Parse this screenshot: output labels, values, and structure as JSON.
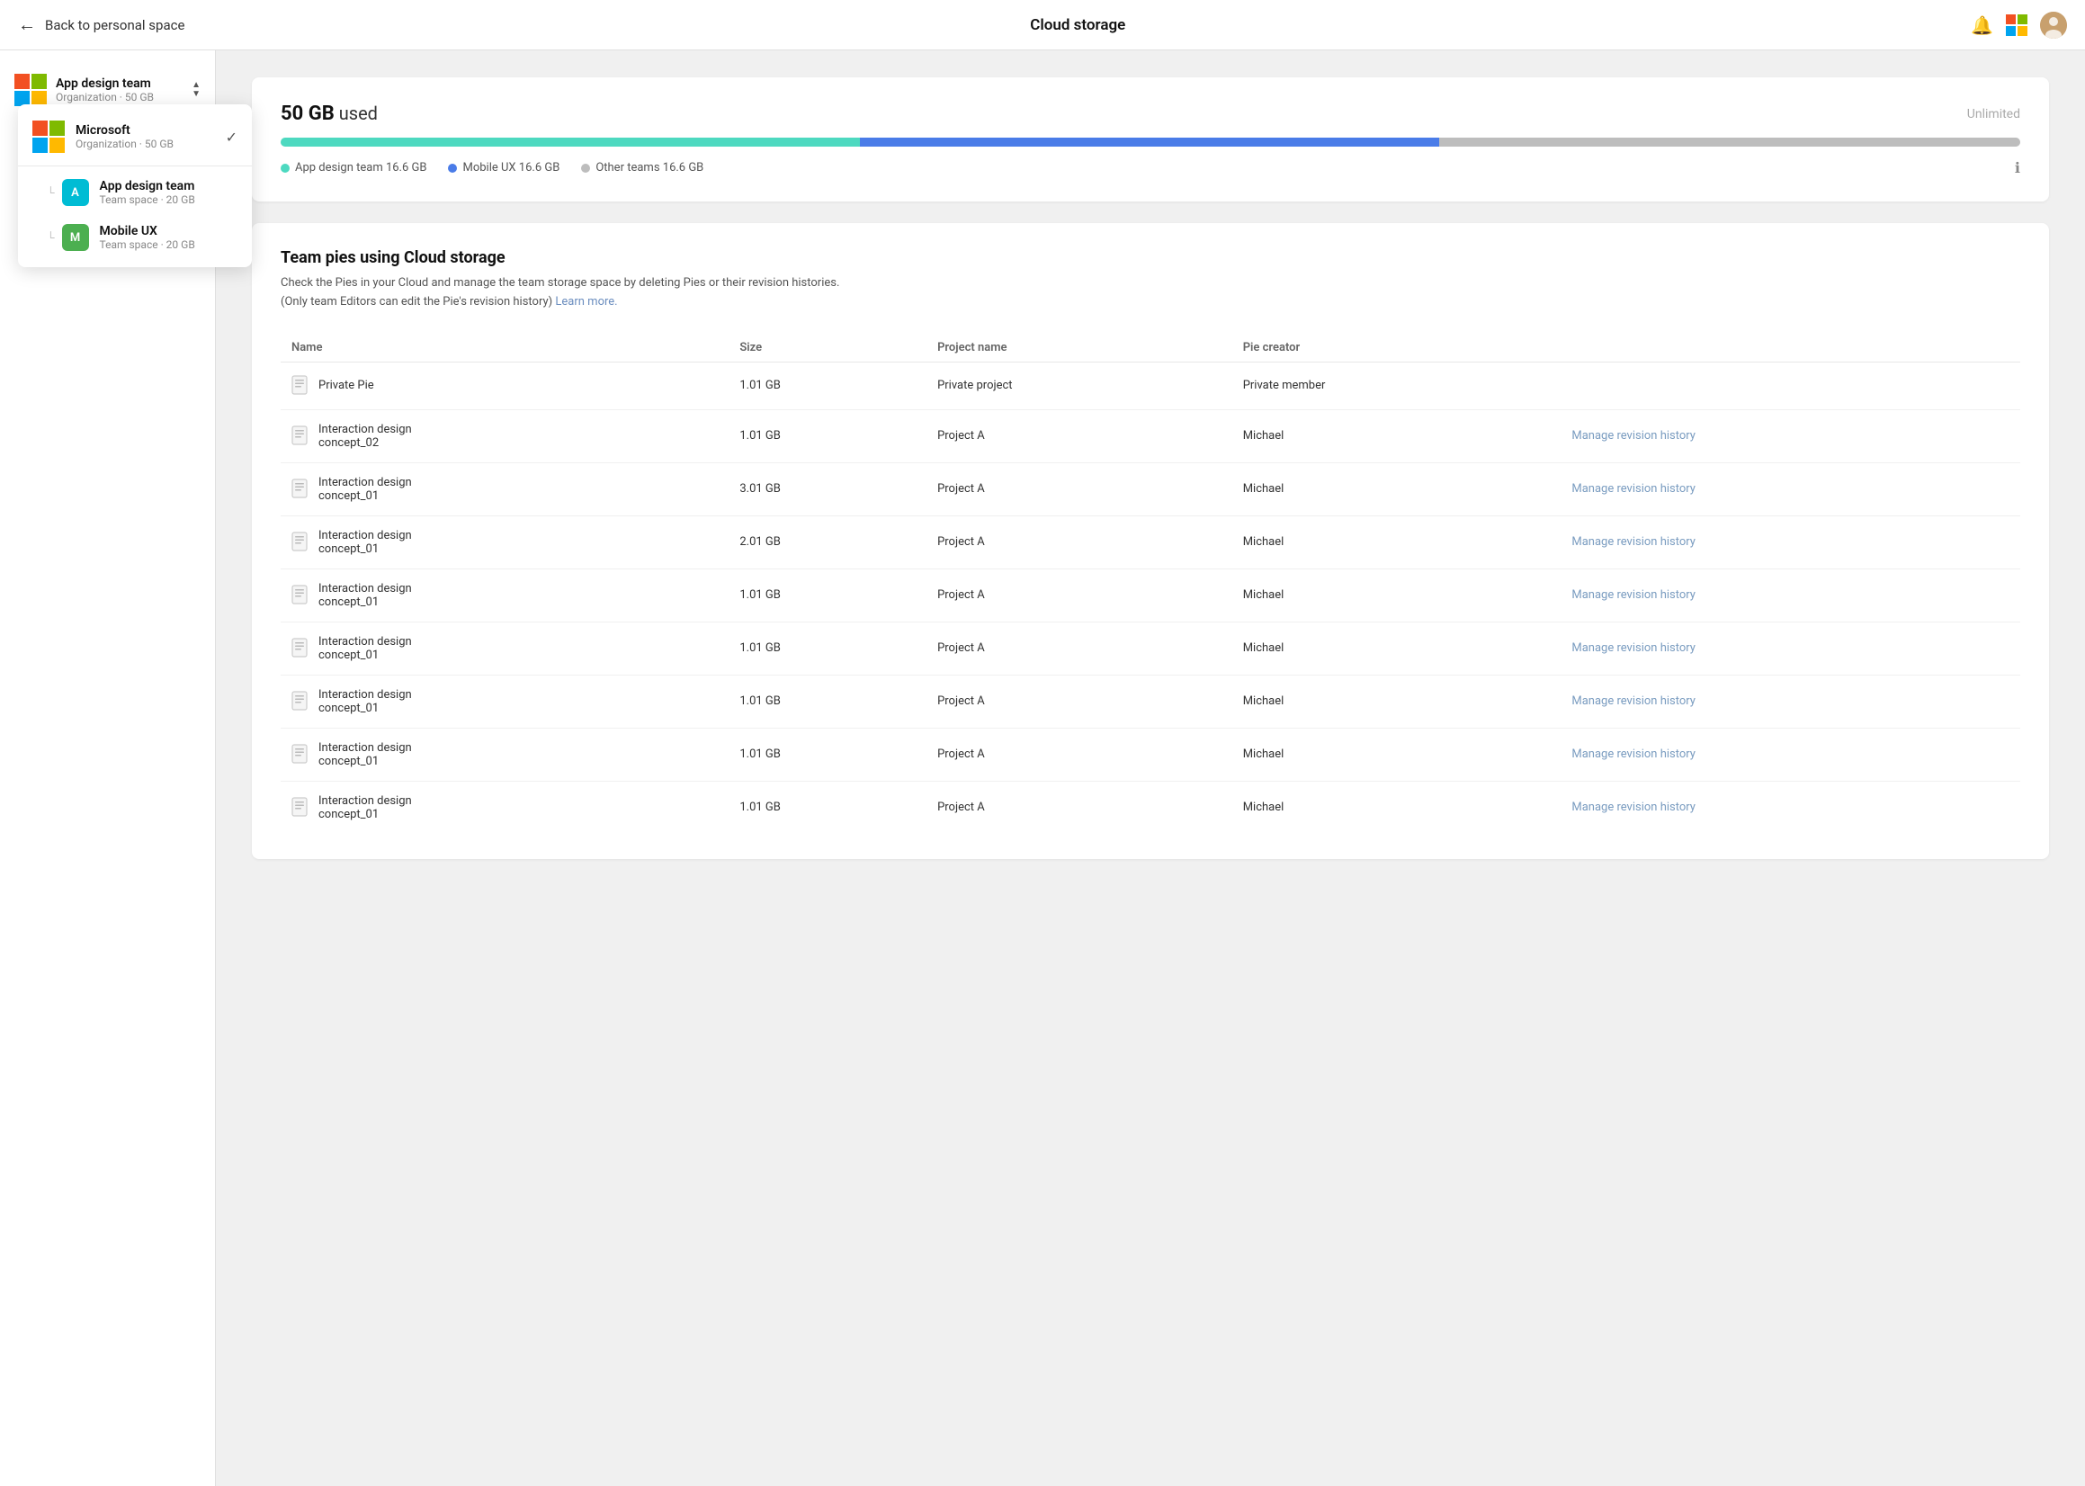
{
  "header": {
    "back_label": "Back to personal space",
    "title": "Cloud storage",
    "avatar_initials": "👤"
  },
  "org_selector": {
    "name": "App design team",
    "sub": "Organization · 50 GB",
    "icon": "ms-logo"
  },
  "dropdown": {
    "items": [
      {
        "type": "org",
        "name": "Microsoft",
        "sub": "Organization · 50 GB",
        "icon": "ms-logo",
        "checked": true
      },
      {
        "type": "team",
        "name": "App design team",
        "sub": "Team space · 20 GB",
        "avatar": "A",
        "color": "#00bcd4"
      },
      {
        "type": "team",
        "name": "Mobile UX",
        "sub": "Team space · 20 GB",
        "avatar": "M",
        "color": "#4caf50"
      }
    ]
  },
  "storage": {
    "used_label": "50 GB",
    "used_suffix": "used",
    "unlimited_label": "Unlimited",
    "bar_segments": [
      {
        "color": "#4dd9c0",
        "pct": 33.3
      },
      {
        "color": "#4a7ce8",
        "pct": 33.3
      },
      {
        "color": "#bdbdbd",
        "pct": 33.4
      }
    ],
    "legend": [
      {
        "color": "#4dd9c0",
        "label": "App design team",
        "size": "16.6 GB"
      },
      {
        "color": "#4a7ce8",
        "label": "Mobile UX",
        "size": "16.6 GB"
      },
      {
        "color": "#bdbdbd",
        "label": "Other teams",
        "size": "16.6 GB"
      }
    ]
  },
  "table_section": {
    "title": "Team pies using Cloud storage",
    "desc1": "Check the Pies in your Cloud and manage the team storage space by deleting Pies or their revision histories.",
    "desc2": "(Only team Editors can edit the Pie's revision history)",
    "learn_more": "Learn more.",
    "columns": [
      "Name",
      "Size",
      "Project name",
      "Pie creator"
    ],
    "rows": [
      {
        "name": "Private Pie",
        "size": "1.01 GB",
        "project": "Private project",
        "creator": "Private member",
        "manage": ""
      },
      {
        "name": "Interaction design\nconcept_02",
        "size": "1.01 GB",
        "project": "Project A",
        "creator": "Michael",
        "manage": "Manage revision history"
      },
      {
        "name": "Interaction design\nconcept_01",
        "size": "3.01 GB",
        "project": "Project A",
        "creator": "Michael",
        "manage": "Manage revision history"
      },
      {
        "name": "Interaction design\nconcept_01",
        "size": "2.01 GB",
        "project": "Project A",
        "creator": "Michael",
        "manage": "Manage revision history"
      },
      {
        "name": "Interaction design\nconcept_01",
        "size": "1.01 GB",
        "project": "Project A",
        "creator": "Michael",
        "manage": "Manage revision history"
      },
      {
        "name": "Interaction design\nconcept_01",
        "size": "1.01 GB",
        "project": "Project A",
        "creator": "Michael",
        "manage": "Manage revision history"
      },
      {
        "name": "Interaction design\nconcept_01",
        "size": "1.01 GB",
        "project": "Project A",
        "creator": "Michael",
        "manage": "Manage revision history"
      },
      {
        "name": "Interaction design\nconcept_01",
        "size": "1.01 GB",
        "project": "Project A",
        "creator": "Michael",
        "manage": "Manage revision history"
      },
      {
        "name": "Interaction design\nconcept_01",
        "size": "1.01 GB",
        "project": "Project A",
        "creator": "Michael",
        "manage": "Manage revision history"
      }
    ]
  },
  "colors": {
    "accent_teal": "#4dd9c0",
    "accent_blue": "#4a7ce8",
    "accent_gray": "#bdbdbd",
    "link_blue": "#7a9cc0"
  }
}
